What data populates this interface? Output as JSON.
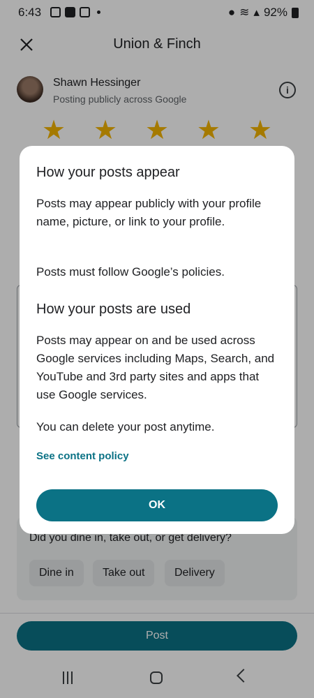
{
  "status_bar": {
    "time": "6:43",
    "battery": "92%"
  },
  "header": {
    "title": "Union & Finch"
  },
  "user": {
    "name": "Shawn Hessinger",
    "subtitle": "Posting publicly across Google"
  },
  "rating": {
    "stars": 5
  },
  "dine_section": {
    "question": "Did you dine in, take out, or get delivery?",
    "options": [
      "Dine in",
      "Take out",
      "Delivery"
    ]
  },
  "post_button": "Post",
  "dialog": {
    "heading1": "How your posts appear",
    "para1": "Posts may appear publicly with your profile name, picture, or link to your profile.",
    "para2": "Posts must follow Google’s policies.",
    "heading2": "How your posts are used",
    "para3": "Posts may appear on and be used across Google services including Maps, Search, and YouTube and 3rd party sites and apps that use Google services.",
    "para4": "You can delete your post anytime.",
    "link": "See content policy",
    "ok": "OK"
  }
}
